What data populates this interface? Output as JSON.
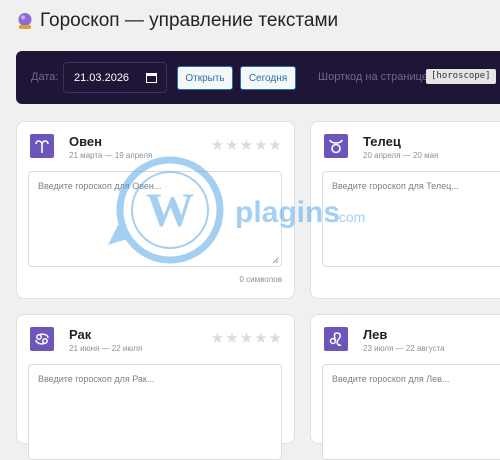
{
  "header": {
    "title": "Гороскоп — управление текстами",
    "icon": "crystal-ball-icon"
  },
  "toolbar": {
    "date_label": "Дата:",
    "date_value": "21.03.2026",
    "open_label": "Открыть",
    "today_label": "Сегодня",
    "shortcode_label": "Шорткод на странице:",
    "shortcode": "[horoscope]"
  },
  "cards": [
    {
      "name": "Овен",
      "dates": "21 марта — 19 апреля",
      "placeholder": "Введите гороскоп для Овен...",
      "counter": "0 символов",
      "icon": "aries-icon",
      "rating": 0
    },
    {
      "name": "Телец",
      "dates": "20 апреля — 20 мая",
      "placeholder": "Введите гороскоп для Телец...",
      "icon": "taurus-icon",
      "rating": 0
    },
    {
      "name": "Рак",
      "dates": "21 июня — 22 июля",
      "placeholder": "Введите гороскоп для Рак...",
      "icon": "cancer-icon",
      "rating": 0
    },
    {
      "name": "Лев",
      "dates": "23 июля — 22 августа",
      "placeholder": "Введите гороскоп для Лев...",
      "icon": "leo-icon",
      "rating": 0
    }
  ],
  "watermark": {
    "text": "plagins",
    "suffix": ".com"
  },
  "colors": {
    "toolbar_bg": "#1f1637",
    "sign_icon_bg": "#6e55b9",
    "button_accent": "#2271b1",
    "watermark": "#5aa9e6"
  }
}
